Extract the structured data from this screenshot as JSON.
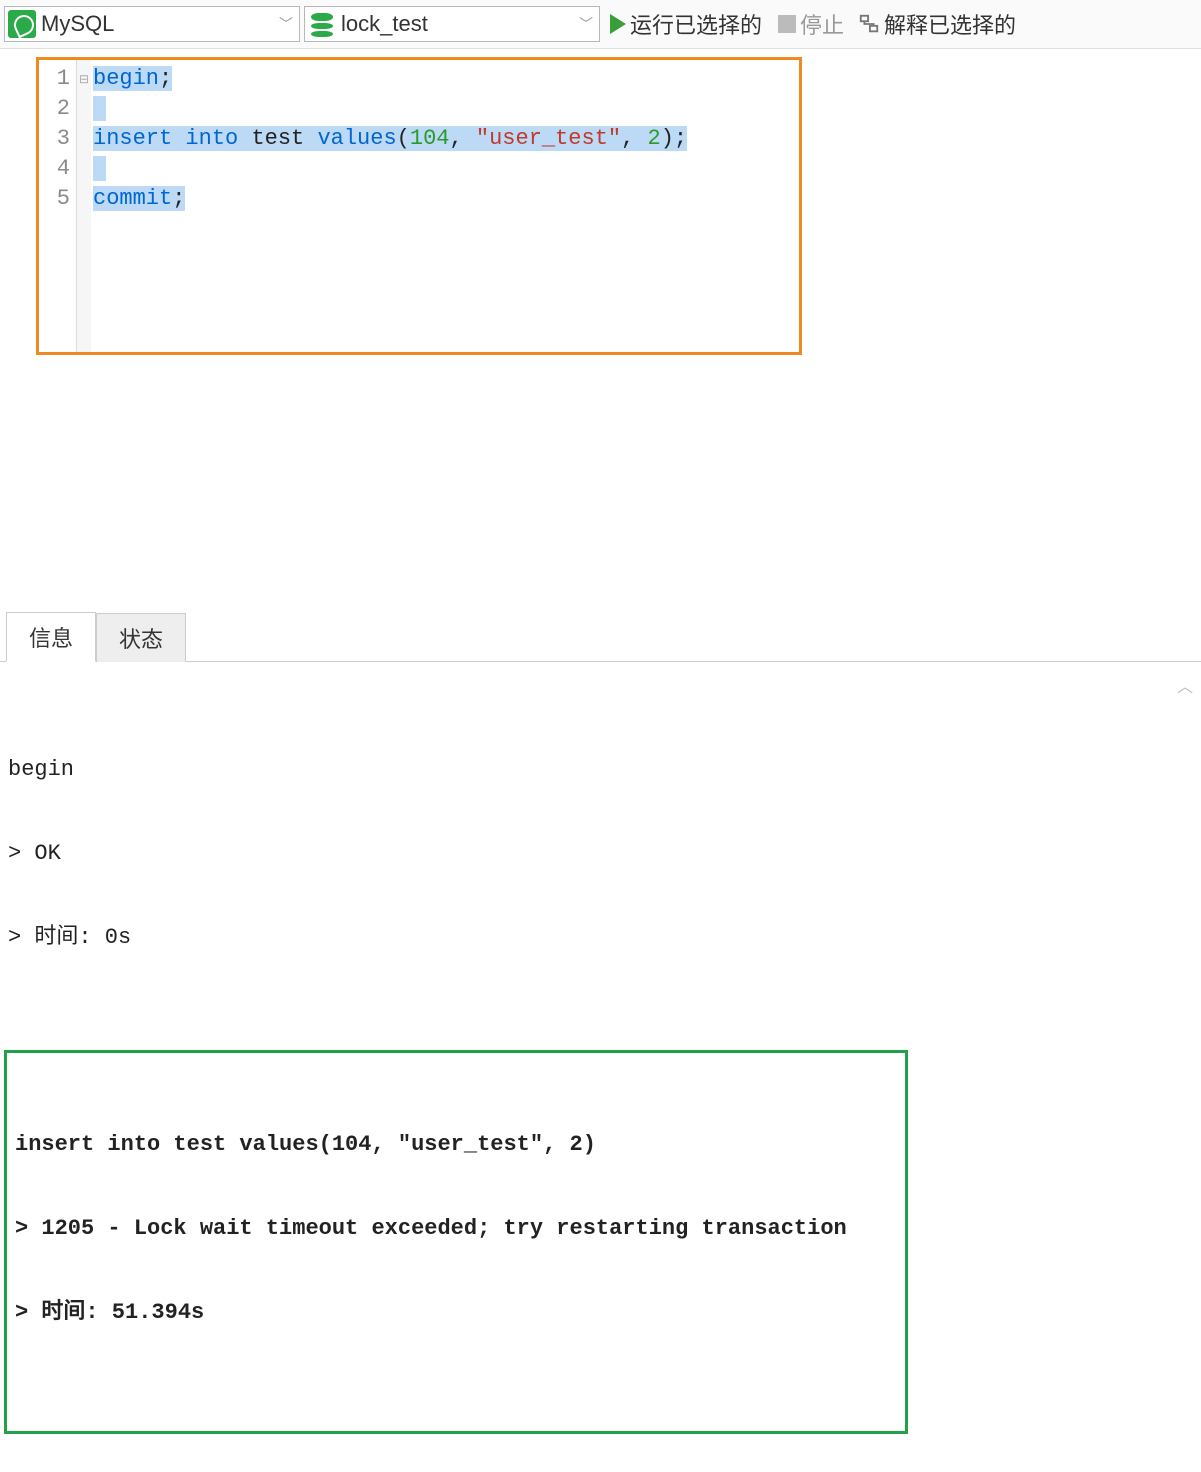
{
  "toolbar": {
    "connection": "MySQL",
    "database": "lock_test",
    "run_label": "运行已选择的",
    "stop_label": "停止",
    "explain_label": "解释已选择的"
  },
  "editor": {
    "lines": [
      {
        "n": 1,
        "tokens": [
          {
            "t": "begin",
            "c": "kw"
          },
          {
            "t": ";",
            "c": "punct"
          }
        ],
        "sel": true
      },
      {
        "n": 2,
        "tokens": [],
        "sel": true
      },
      {
        "n": 3,
        "tokens": [
          {
            "t": "insert",
            "c": "kw"
          },
          {
            "t": " ",
            "c": ""
          },
          {
            "t": "into",
            "c": "kw"
          },
          {
            "t": " ",
            "c": ""
          },
          {
            "t": "test",
            "c": "ident"
          },
          {
            "t": " ",
            "c": ""
          },
          {
            "t": "values",
            "c": "kw"
          },
          {
            "t": "(",
            "c": "punct"
          },
          {
            "t": "104",
            "c": "num"
          },
          {
            "t": ", ",
            "c": "punct"
          },
          {
            "t": "\"user_test\"",
            "c": "str"
          },
          {
            "t": ", ",
            "c": "punct"
          },
          {
            "t": "2",
            "c": "num"
          },
          {
            "t": ");",
            "c": "punct"
          }
        ],
        "sel": true
      },
      {
        "n": 4,
        "tokens": [],
        "sel": true
      },
      {
        "n": 5,
        "tokens": [
          {
            "t": "commit",
            "c": "kw"
          },
          {
            "t": ";",
            "c": "punct"
          }
        ],
        "sel": true
      }
    ]
  },
  "tabs": {
    "info": "信息",
    "status": "状态"
  },
  "output": {
    "line1": "begin",
    "line2": "> OK",
    "line3": "> 时间: 0s",
    "hl_line1": "insert into test values(104, \"user_test\", 2)",
    "hl_line2": "> 1205 - Lock wait timeout exceeded; try restarting transaction",
    "hl_line3": "> 时间: 51.394s"
  }
}
